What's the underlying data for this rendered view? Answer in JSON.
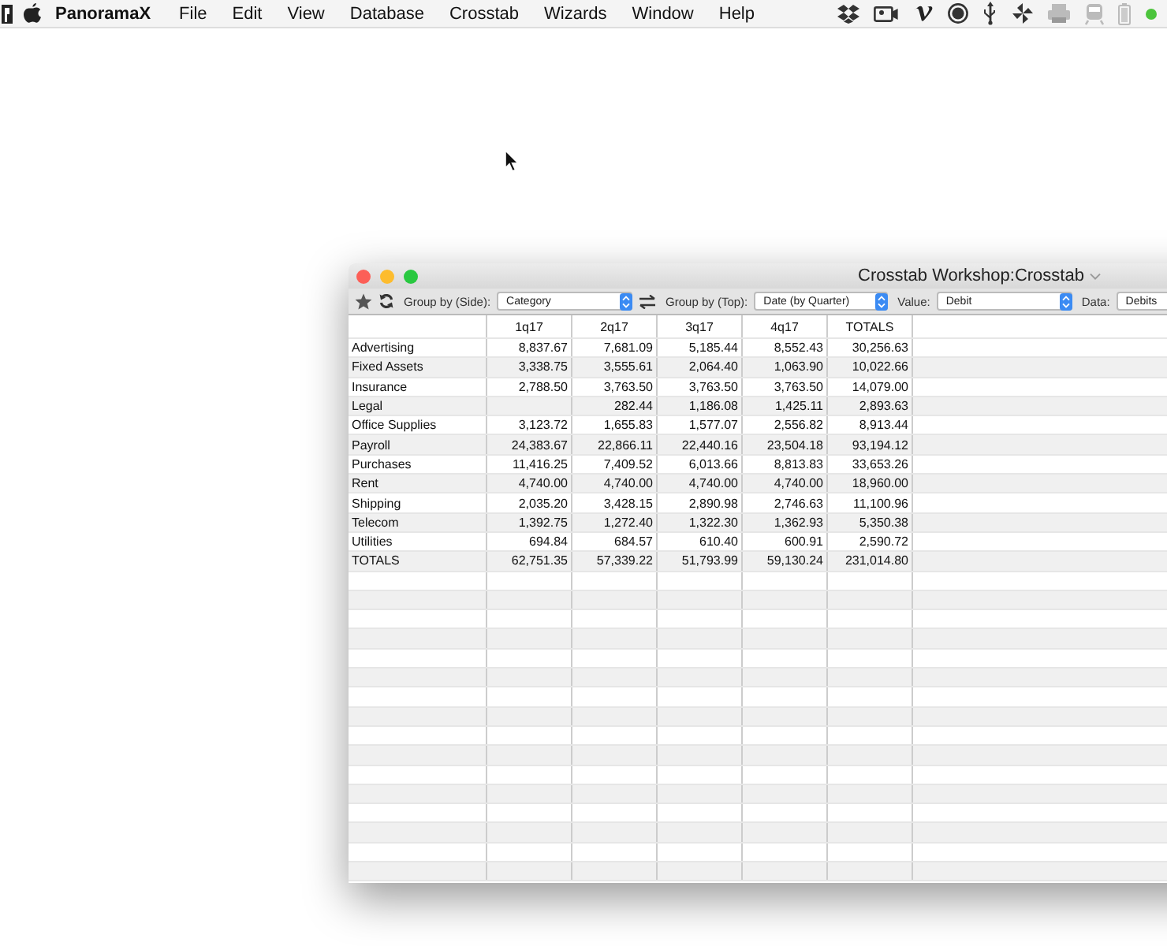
{
  "menu_bar": {
    "app_name": "PanoramaX",
    "menus": [
      "File",
      "Edit",
      "View",
      "Database",
      "Crosstab",
      "Wizards",
      "Window",
      "Help"
    ]
  },
  "window": {
    "title": "Crosstab Workshop:Crosstab",
    "toolbar": [
      {
        "label": "Group by (Side):",
        "value": "Category"
      },
      {
        "label": "Group by (Top):",
        "value": "Date (by Quarter)"
      },
      {
        "label": "Value:",
        "value": "Debit"
      },
      {
        "label": "Data:",
        "value": "Debits"
      }
    ],
    "table": {
      "columns": [
        "1q17",
        "2q17",
        "3q17",
        "4q17",
        "TOTALS"
      ],
      "rows": [
        {
          "label": "Advertising",
          "values": [
            "8,837.67",
            "7,681.09",
            "5,185.44",
            "8,552.43",
            "30,256.63"
          ]
        },
        {
          "label": "Fixed Assets",
          "values": [
            "3,338.75",
            "3,555.61",
            "2,064.40",
            "1,063.90",
            "10,022.66"
          ]
        },
        {
          "label": "Insurance",
          "values": [
            "2,788.50",
            "3,763.50",
            "3,763.50",
            "3,763.50",
            "14,079.00"
          ]
        },
        {
          "label": "Legal",
          "values": {
            "q2": "282.44",
            "q3": "1,186.08",
            "q4": "1,425.11",
            "total": "2,893.63"
          }
        },
        {
          "label": "Office Supplies",
          "values": [
            "3,123.72",
            "1,655.83",
            "1,577.07",
            "2,556.82",
            "8,913.44"
          ]
        },
        {
          "label": "Payroll",
          "values": [
            "24,383.67",
            "22,866.11",
            "22,440.16",
            "23,504.18",
            "93,194.12"
          ]
        },
        {
          "label": "Purchases",
          "values": [
            "11,416.25",
            "7,409.52",
            "6,013.66",
            "8,813.83",
            "33,653.26"
          ]
        },
        {
          "label": "Rent",
          "values": [
            "4,740.00",
            "4,740.00",
            "4,740.00",
            "4,740.00",
            "18,960.00"
          ]
        },
        {
          "label": "Shipping",
          "values": [
            "2,035.20",
            "3,428.15",
            "2,890.98",
            "2,746.63",
            "11,100.96"
          ]
        },
        {
          "label": "Telecom",
          "values": [
            "1,392.75",
            "1,272.40",
            "1,322.30",
            "1,362.93",
            "5,350.38"
          ]
        },
        {
          "label": "Utilities",
          "values": [
            "694.84",
            "684.57",
            "610.40",
            "600.91",
            "2,590.72"
          ]
        },
        {
          "label": "TOTALS",
          "values": [
            "62,751.35",
            "57,339.22",
            "51,793.99",
            "59,130.24",
            "231,014.80"
          ]
        }
      ]
    }
  }
}
